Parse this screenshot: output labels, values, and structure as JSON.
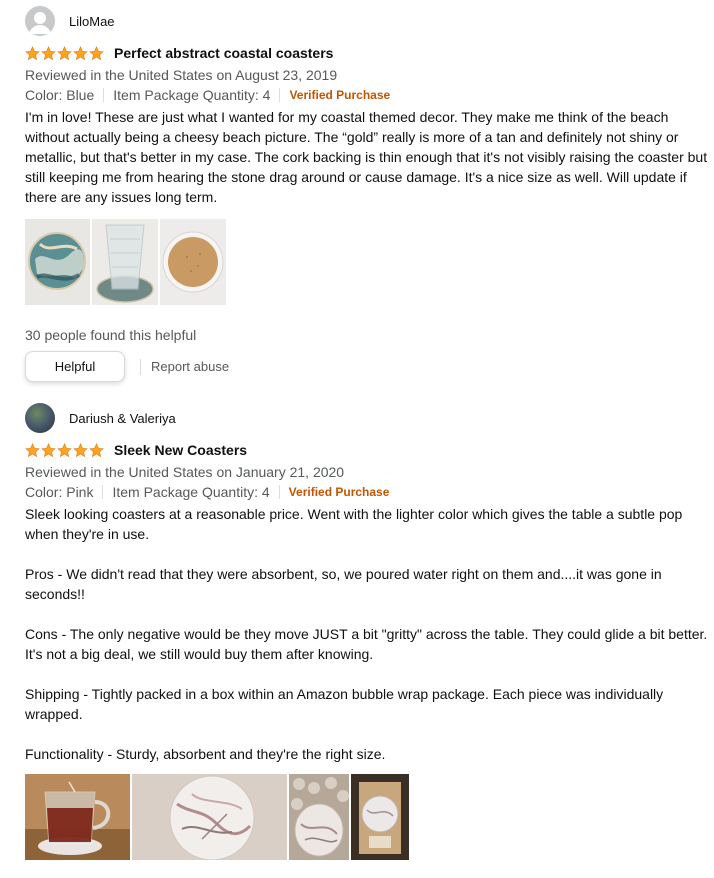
{
  "reviews": [
    {
      "profile_name": "LiloMae",
      "rating": 5,
      "title": "Perfect abstract coastal coasters",
      "date": "Reviewed in the United States on August 23, 2019",
      "color": "Color: Blue",
      "quantity": "Item Package Quantity: 4",
      "verified": "Verified Purchase",
      "body": "I'm in love! These are just what I wanted for my coastal themed decor. They make me think of the beach without actually being a cheesy beach picture. The “gold” really is more of a tan and definitely not shiny or metallic, but that's better in my case. The cork backing is thin enough that it's not visibly raising the coaster but still keeping me from hearing the stone drag around or cause damage. It's a nice size as well. Will update if there are any issues long term.",
      "helpful_count": "30 people found this helpful",
      "helpful_label": "Helpful",
      "report_label": "Report abuse"
    },
    {
      "profile_name": "Dariush & Valeriya",
      "rating": 5,
      "title": "Sleek New Coasters",
      "date": "Reviewed in the United States on January 21, 2020",
      "color": "Color: Pink",
      "quantity": "Item Package Quantity: 4",
      "verified": "Verified Purchase",
      "body": "Sleek looking coasters at a reasonable price. Went with the lighter color which gives the table a subtle pop when they're in use.\n\nPros - We didn't read that they were absorbent, so, we poured water right on them and....it was gone in seconds!!\n\nCons - The only negative would be they move JUST a bit \"gritty\" across the table. They could glide a bit better. It's not a big deal, we still would buy them after knowing.\n\nShipping - Tightly packed in a box within an Amazon bubble wrap package. Each piece was individually wrapped.\n\nFunctionality - Sturdy, absorbent and they're the right size."
    }
  ],
  "colors": {
    "star": "#ffa41c",
    "verified": "#c45500",
    "secondary_text": "#565959"
  }
}
